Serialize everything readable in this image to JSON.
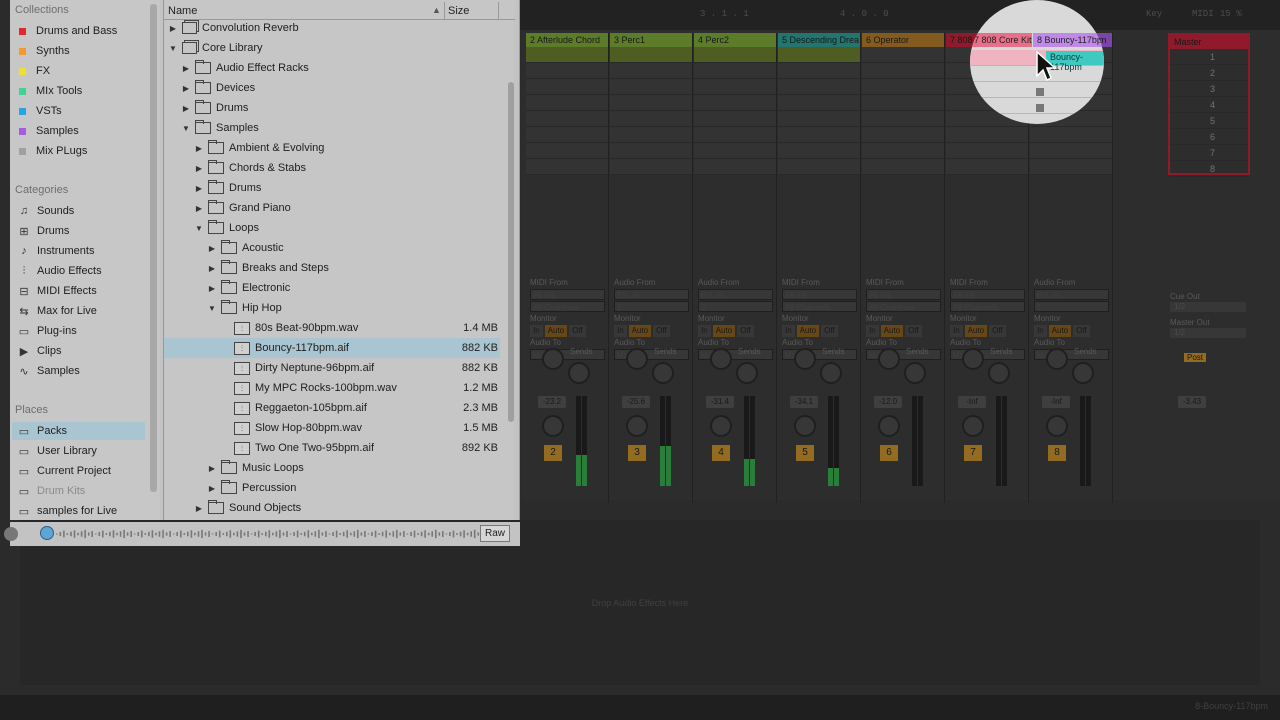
{
  "collections": {
    "heading": "Collections",
    "items": [
      {
        "label": "Drums and Bass",
        "color": "#e0282f"
      },
      {
        "label": "Synths",
        "color": "#f39a28"
      },
      {
        "label": "FX",
        "color": "#f0e02e"
      },
      {
        "label": "MIx Tools",
        "color": "#3ed494"
      },
      {
        "label": "VSTs",
        "color": "#24a6e4"
      },
      {
        "label": "Samples",
        "color": "#a55ce1"
      },
      {
        "label": "Mix PLugs",
        "color": "#a0a0a0"
      }
    ]
  },
  "categories": {
    "heading": "Categories",
    "items": [
      {
        "label": "Sounds",
        "icon": "sounds-icon"
      },
      {
        "label": "Drums",
        "icon": "drums-icon"
      },
      {
        "label": "Instruments",
        "icon": "instruments-icon"
      },
      {
        "label": "Audio Effects",
        "icon": "audio-effects-icon"
      },
      {
        "label": "MIDI Effects",
        "icon": "midi-effects-icon"
      },
      {
        "label": "Max for Live",
        "icon": "max-for-live-icon"
      },
      {
        "label": "Plug-ins",
        "icon": "plug-ins-icon"
      },
      {
        "label": "Clips",
        "icon": "clips-icon"
      },
      {
        "label": "Samples",
        "icon": "samples-icon"
      }
    ]
  },
  "places": {
    "heading": "Places",
    "items": [
      {
        "label": "Packs",
        "selected": true
      },
      {
        "label": "User Library"
      },
      {
        "label": "Current Project"
      },
      {
        "label": "Drum Kits",
        "disabled": true
      },
      {
        "label": "samples for Live"
      }
    ]
  },
  "filelist": {
    "col_name": "Name",
    "col_size": "Size",
    "sort_indicator": "▲",
    "rows": [
      {
        "label": "Convolution Reverb",
        "kind": "pack",
        "depth": 0,
        "arrow": "▶"
      },
      {
        "label": "Core Library",
        "kind": "pack",
        "depth": 0,
        "arrow": "▼"
      },
      {
        "label": "Audio Effect Racks",
        "kind": "folder",
        "depth": 1,
        "arrow": "▶"
      },
      {
        "label": "Devices",
        "kind": "folder",
        "depth": 1,
        "arrow": "▶"
      },
      {
        "label": "Drums",
        "kind": "folder",
        "depth": 1,
        "arrow": "▶"
      },
      {
        "label": "Samples",
        "kind": "folder",
        "depth": 1,
        "arrow": "▼"
      },
      {
        "label": "Ambient & Evolving",
        "kind": "folder",
        "depth": 2,
        "arrow": "▶"
      },
      {
        "label": "Chords & Stabs",
        "kind": "folder",
        "depth": 2,
        "arrow": "▶"
      },
      {
        "label": "Drums",
        "kind": "folder",
        "depth": 2,
        "arrow": "▶"
      },
      {
        "label": "Grand Piano",
        "kind": "folder",
        "depth": 2,
        "arrow": "▶"
      },
      {
        "label": "Loops",
        "kind": "folder",
        "depth": 2,
        "arrow": "▼"
      },
      {
        "label": "Acoustic",
        "kind": "folder",
        "depth": 3,
        "arrow": "▶"
      },
      {
        "label": "Breaks and Steps",
        "kind": "folder",
        "depth": 3,
        "arrow": "▶"
      },
      {
        "label": "Electronic",
        "kind": "folder",
        "depth": 3,
        "arrow": "▶"
      },
      {
        "label": "Hip Hop",
        "kind": "folder",
        "depth": 3,
        "arrow": "▼"
      },
      {
        "label": "80s Beat-90bpm.wav",
        "kind": "audio",
        "depth": 4,
        "size": "1.4 MB"
      },
      {
        "label": "Bouncy-117bpm.aif",
        "kind": "audio",
        "depth": 4,
        "size": "882 KB",
        "selected": true
      },
      {
        "label": "Dirty Neptune-96bpm.aif",
        "kind": "audio",
        "depth": 4,
        "size": "882 KB"
      },
      {
        "label": "My MPC Rocks-100bpm.wav",
        "kind": "audio",
        "depth": 4,
        "size": "1.2 MB"
      },
      {
        "label": "Reggaeton-105bpm.aif",
        "kind": "audio",
        "depth": 4,
        "size": "2.3 MB"
      },
      {
        "label": "Slow Hop-80bpm.wav",
        "kind": "audio",
        "depth": 4,
        "size": "1.5 MB"
      },
      {
        "label": "Two One Two-95bpm.aif",
        "kind": "audio",
        "depth": 4,
        "size": "892 KB"
      },
      {
        "label": "Music Loops",
        "kind": "folder",
        "depth": 3,
        "arrow": "▶"
      },
      {
        "label": "Percussion",
        "kind": "folder",
        "depth": 3,
        "arrow": "▶"
      },
      {
        "label": "Sound Objects",
        "kind": "folder",
        "depth": 2,
        "arrow": "▶"
      }
    ]
  },
  "preview": {
    "raw_label": "Raw"
  },
  "transport": {
    "position": "3 . 1 . 1",
    "loop_length": "4 . 0 . 0",
    "key_label": "Key",
    "midi_label": "MIDI",
    "cpu": "15 %"
  },
  "tracks": [
    {
      "name": "2 Afterlude Chord",
      "color": "#7ba638",
      "number": "2",
      "volume": "-23.2",
      "input_type": "MIDI From",
      "input": "All Ins",
      "channel": "All Channels",
      "sends_label": "Sends",
      "meter": 0.35
    },
    {
      "name": "3 Perc1",
      "color": "#7ba638",
      "number": "3",
      "volume": "-25.6",
      "input_type": "Audio From",
      "input": "Ext. In",
      "channel": "1",
      "sends_label": "Sends",
      "meter": 0.45
    },
    {
      "name": "4 Perc2",
      "color": "#7ba638",
      "number": "4",
      "volume": "-31.4",
      "input_type": "Audio From",
      "input": "Ext. In",
      "channel": "2",
      "sends_label": "Sends",
      "meter": 0.3
    },
    {
      "name": "5 Descending Drea",
      "color": "#2c9e96",
      "number": "5",
      "volume": "-34.1",
      "input_type": "MIDI From",
      "input": "All Ins",
      "channel": "All Channels",
      "sends_label": "Sends",
      "meter": 0.2
    },
    {
      "name": "6 Operator",
      "color": "#b07a2a",
      "number": "6",
      "volume": "-12.0",
      "input_type": "MIDI From",
      "input": "All Ins",
      "channel": "All Channels",
      "sends_label": "Sends",
      "meter": 0.0
    },
    {
      "name": "7 808 Core Kit",
      "color": "#c1233a",
      "number": "7",
      "volume": "-Inf",
      "input_type": "MIDI From",
      "input": "All Ins",
      "channel": "All Channels",
      "sends_label": "Sends",
      "meter": 0.0
    },
    {
      "name": "8 Bouncy-117bpm",
      "color": "#a55ce1",
      "number": "8",
      "volume": "-Inf",
      "input_type": "Audio From",
      "input": "Ext. In",
      "channel": "1",
      "sends_label": "Sends",
      "meter": 0.0
    }
  ],
  "track_labels": {
    "monitor": "Monitor",
    "monitor_in": "In",
    "monitor_auto": "Auto",
    "monitor_off": "Off",
    "audio_to": "Audio To",
    "audio_to_value": "Master"
  },
  "clip_in_spotlight": "Bouncy-117bpm",
  "master": {
    "name": "Master",
    "scenes": [
      "1",
      "2",
      "3",
      "4",
      "5",
      "6",
      "7",
      "8"
    ],
    "cue_out_label": "Cue Out",
    "cue_out": "1/2",
    "master_out_label": "Master Out",
    "master_out": "1/2",
    "volume": "-3.43",
    "post_label": "Post"
  },
  "detail": {
    "drop_message": "Drop Audio Effects Here"
  },
  "status": {
    "selected_track": "8-Bouncy-117bpm"
  }
}
